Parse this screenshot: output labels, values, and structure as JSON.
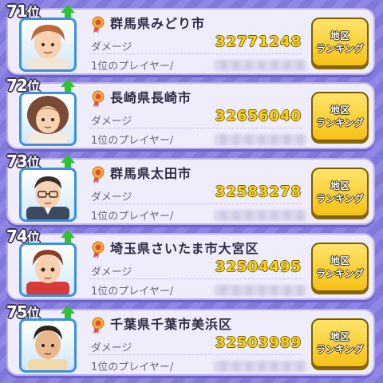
{
  "ranking": {
    "unit": "位",
    "damage_label": "ダメージ",
    "player_label": "1位のプレイヤー/",
    "button_line1": "地区",
    "button_line2": "ランキング",
    "entries": [
      {
        "rank": "71",
        "area": "群馬県みどり市",
        "damage": "32771248",
        "avatar": "boy-brown-hair-avatar"
      },
      {
        "rank": "72",
        "area": "長崎県長崎市",
        "damage": "32656040",
        "avatar": "woman-curly-hair-avatar"
      },
      {
        "rank": "73",
        "area": "群馬県太田市",
        "damage": "32583278",
        "avatar": "man-glasses-avatar"
      },
      {
        "rank": "74",
        "area": "埼玉県さいたま市大宮区",
        "damage": "32504495",
        "avatar": "boy-red-jacket-avatar"
      },
      {
        "rank": "75",
        "area": "千葉県千葉市美浜区",
        "damage": "32503989",
        "avatar": "boy-dark-hair-avatar"
      }
    ]
  },
  "colors": {
    "background": "#8f86e6",
    "card": "#efecfb",
    "damage_value": "#f7d521",
    "button": "#f6c116",
    "rank_up_arrow": "#2fc12f",
    "avatar_border": "#3d8fe0"
  }
}
